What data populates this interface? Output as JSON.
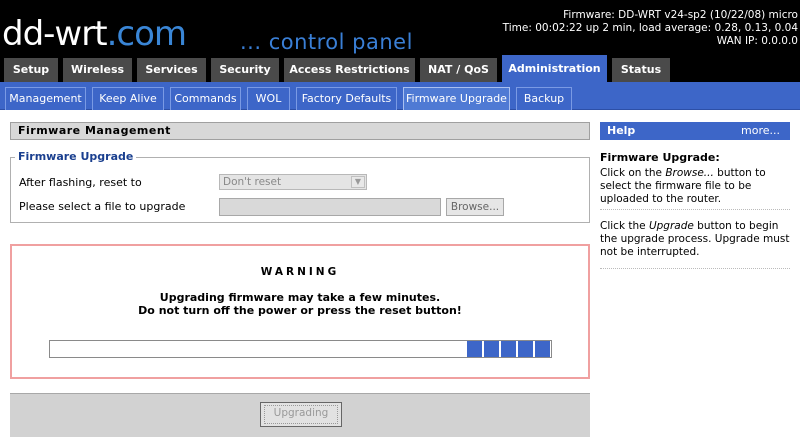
{
  "header": {
    "logo_part1": "dd-wrt",
    "logo_part2": ".com",
    "subtitle": "... control panel",
    "firmware": "Firmware: DD-WRT v24-sp2 (10/22/08) micro",
    "time": "Time: 00:02:22 up 2 min, load average: 0.28, 0.13, 0.04",
    "wan_ip": "WAN IP: 0.0.0.0"
  },
  "main_tabs": [
    {
      "label": "Setup"
    },
    {
      "label": "Wireless"
    },
    {
      "label": "Services"
    },
    {
      "label": "Security"
    },
    {
      "label": "Access Restrictions"
    },
    {
      "label": "NAT / QoS"
    },
    {
      "label": "Administration"
    },
    {
      "label": "Status"
    }
  ],
  "active_main_tab": "Administration",
  "sub_tabs": [
    {
      "label": "Management"
    },
    {
      "label": "Keep Alive"
    },
    {
      "label": "Commands"
    },
    {
      "label": "WOL"
    },
    {
      "label": "Factory Defaults"
    },
    {
      "label": "Firmware Upgrade"
    },
    {
      "label": "Backup"
    }
  ],
  "active_sub_tab": "Firmware Upgrade",
  "section": {
    "title": "Firmware Management",
    "legend": "Firmware Upgrade",
    "reset_label": "After flashing, reset to",
    "reset_value": "Don't reset",
    "file_label": "Please select a file to upgrade",
    "file_value": "",
    "browse_label": "Browse..."
  },
  "warning": {
    "title": "WARNING",
    "line1": "Upgrading firmware may take a few minutes.",
    "line2": "Do not turn off the power or press the reset button!",
    "progress_blocks": 5
  },
  "upgrade_button": "Upgrading",
  "help": {
    "header": "Help",
    "more": "more...",
    "title": "Firmware Upgrade:",
    "p1_a": "Click on the ",
    "p1_em": "Browse...",
    "p1_b": " button to select the firmware file to be uploaded to the router.",
    "p2_a": "Click the ",
    "p2_em": "Upgrade",
    "p2_b": " button to begin the upgrade process. Upgrade must not be interrupted."
  },
  "colors": {
    "accent_blue": "#3d66c8",
    "tab_gray": "#4a4a4a",
    "warning_border": "#f0a0a0"
  }
}
